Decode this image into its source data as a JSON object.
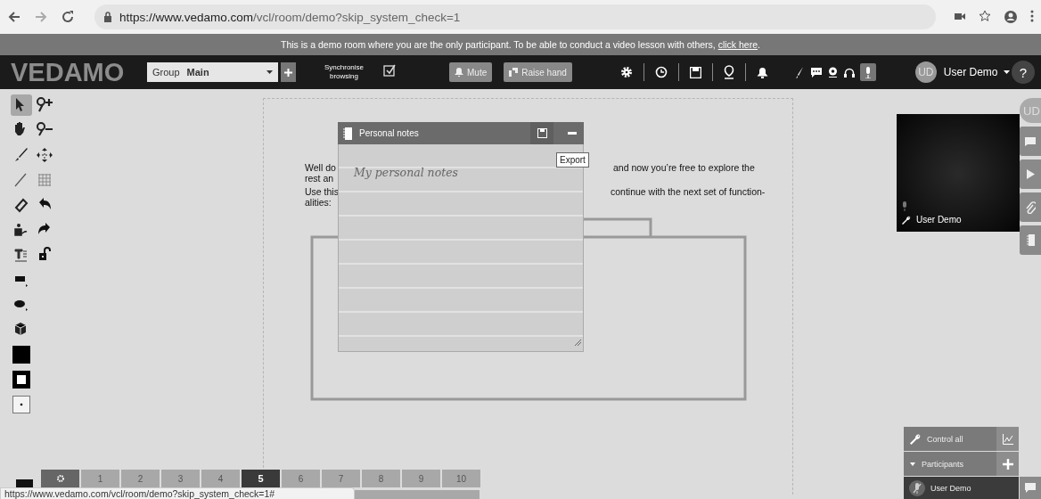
{
  "browser": {
    "url_host": "https://www.vedamo.com",
    "url_path": "/vcl/room/demo?skip_system_check=1"
  },
  "banner": {
    "text": "This is a demo room where you are the only participant. To be able to conduct a video lesson with others, ",
    "link": "click here",
    "text_end": "."
  },
  "topbar": {
    "logo": "VEDAMO",
    "group_label": "Group",
    "group_value": "Main",
    "sync_label": "Synchronise browsing",
    "sync_checked": true,
    "mute": "Mute",
    "raise_hand": "Raise hand",
    "mic_active": true,
    "avatar": "UD",
    "user": "User Demo",
    "help": "?"
  },
  "tools_left": [
    {
      "kind": "select",
      "selected": true
    },
    {
      "kind": "hand",
      "selected": false
    },
    {
      "kind": "brush",
      "selected": false
    },
    {
      "kind": "line",
      "selected": false
    },
    {
      "kind": "eraser",
      "selected": false
    },
    {
      "kind": "stamp",
      "selected": false
    },
    {
      "kind": "text",
      "selected": false
    },
    {
      "kind": "rectangle",
      "selected": false
    },
    {
      "kind": "ellipse",
      "selected": false
    },
    {
      "kind": "cube",
      "selected": false
    },
    {
      "kind": "fill",
      "selected": false
    },
    {
      "kind": "stroke",
      "selected": false
    },
    {
      "kind": "size",
      "selected": false
    }
  ],
  "tools_right": [
    {
      "kind": "zoom-in",
      "selected": false
    },
    {
      "kind": "zoom-out",
      "selected": false
    },
    {
      "kind": "move",
      "selected": false
    },
    {
      "kind": "grid",
      "selected": false
    },
    {
      "kind": "undo",
      "selected": false
    },
    {
      "kind": "redo",
      "selected": false
    },
    {
      "kind": "lock",
      "selected": false
    }
  ],
  "board": {
    "text_left": [
      "Well do",
      "rest an",
      "Use this",
      "alities:"
    ],
    "text_right": [
      "and now you’re free to explore the",
      "continue with the next set of function-"
    ]
  },
  "notes": {
    "title": "Personal notes",
    "placeholder": "My personal notes",
    "tooltip": "Export"
  },
  "video": {
    "name": "User Demo"
  },
  "side_tabs": [
    {
      "kind": "avatar",
      "label": "UD"
    },
    {
      "kind": "chat"
    },
    {
      "kind": "media"
    },
    {
      "kind": "attachments"
    },
    {
      "kind": "notes"
    }
  ],
  "participants_panel": {
    "control_all": "Control all",
    "participants": "Participants",
    "expanded": true,
    "user": "User Demo",
    "muted": true
  },
  "pages": [
    {
      "kind": "settings",
      "selected": false
    },
    {
      "kind": "page",
      "label": "1",
      "selected": false
    },
    {
      "kind": "page",
      "label": "2",
      "selected": false
    },
    {
      "kind": "page",
      "label": "3",
      "selected": false
    },
    {
      "kind": "page",
      "label": "4",
      "selected": false
    },
    {
      "kind": "page",
      "label": "5",
      "selected": true
    },
    {
      "kind": "page",
      "label": "6",
      "selected": false
    },
    {
      "kind": "page",
      "label": "7",
      "selected": false
    },
    {
      "kind": "page",
      "label": "8",
      "selected": false
    },
    {
      "kind": "page",
      "label": "9",
      "selected": false
    },
    {
      "kind": "page",
      "label": "10",
      "selected": false
    }
  ],
  "status_url": "https://www.vedamo.com/vcl/room/demo?skip_system_check=1#"
}
